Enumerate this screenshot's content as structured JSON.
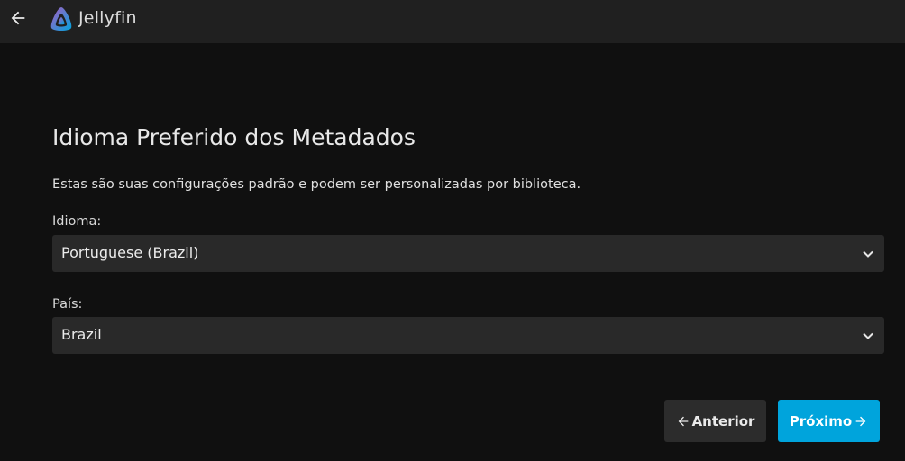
{
  "header": {
    "app_name": "Jellyfin",
    "back_icon": "arrow-left-icon",
    "logo_icon": "jellyfin-logo-icon"
  },
  "main": {
    "title": "Idioma Preferido dos Metadados",
    "description": "Estas são suas configurações padrão e podem ser personalizadas por biblioteca.",
    "language": {
      "label": "Idioma:",
      "value": "Portuguese (Brazil)"
    },
    "country": {
      "label": "País:",
      "value": "Brazil"
    }
  },
  "buttons": {
    "previous_label": "Anterior",
    "next_label": "Próximo"
  },
  "colors": {
    "accent": "#00a4dc",
    "background": "#101010",
    "header": "#202020",
    "select": "#292929"
  }
}
